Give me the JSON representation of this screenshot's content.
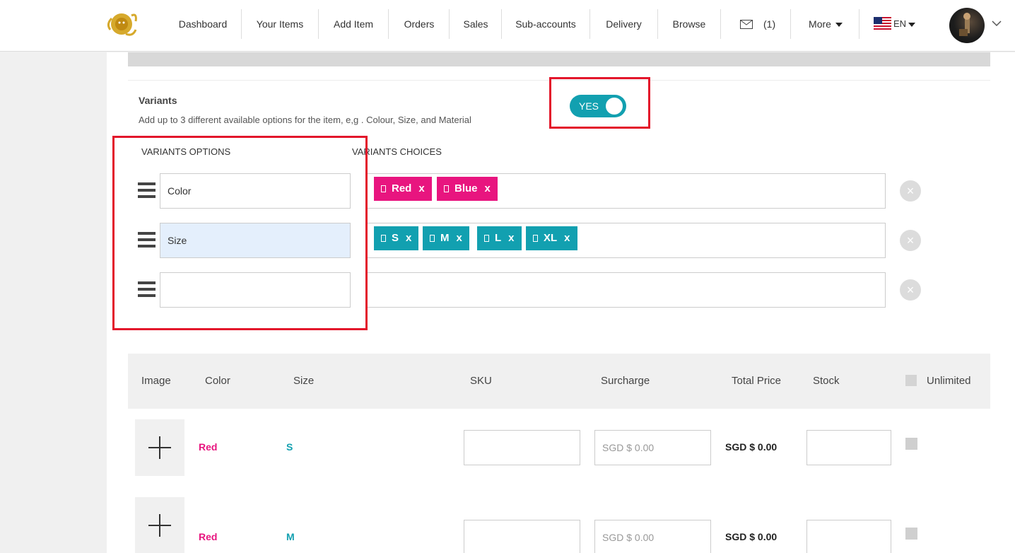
{
  "nav": {
    "items": [
      "Dashboard",
      "Your Items",
      "Add Item",
      "Orders",
      "Sales",
      "Sub-accounts",
      "Delivery",
      "Browse"
    ],
    "inbox_count": "(1)",
    "more_label": "More",
    "language": "EN"
  },
  "variants": {
    "title": "Variants",
    "description": "Add up to 3 different available options for the item, e,g . Colour, Size, and Material",
    "toggle_label": "YES",
    "options_header": "VARIANTS OPTIONS",
    "choices_header": "VARIANTS CHOICES",
    "options": [
      {
        "value": "Color",
        "choices": [
          "Red",
          "Blue"
        ],
        "chip_color": "#e8157f"
      },
      {
        "value": "Size",
        "choices": [
          "S",
          "M",
          "L",
          "XL"
        ],
        "chip_color": "#12a0b0"
      },
      {
        "value": "",
        "choices": []
      }
    ],
    "chip_remove": "x",
    "row_remove": "×"
  },
  "table": {
    "headers": [
      "Image",
      "Color",
      "Size",
      "SKU",
      "Surcharge",
      "Total Price",
      "Stock",
      "Unlimited"
    ],
    "rows": [
      {
        "color": "Red",
        "size": "S",
        "sku": "",
        "surcharge_placeholder": "SGD $ 0.00",
        "total_price": "SGD $ 0.00",
        "stock": ""
      },
      {
        "color": "Red",
        "size": "M",
        "sku": "",
        "surcharge_placeholder": "SGD $ 0.00",
        "total_price": "SGD $ 0.00",
        "stock": ""
      }
    ]
  },
  "colors": {
    "accent_teal": "#12a0b0",
    "accent_pink": "#e8157f",
    "highlight_red": "#e3162b"
  }
}
